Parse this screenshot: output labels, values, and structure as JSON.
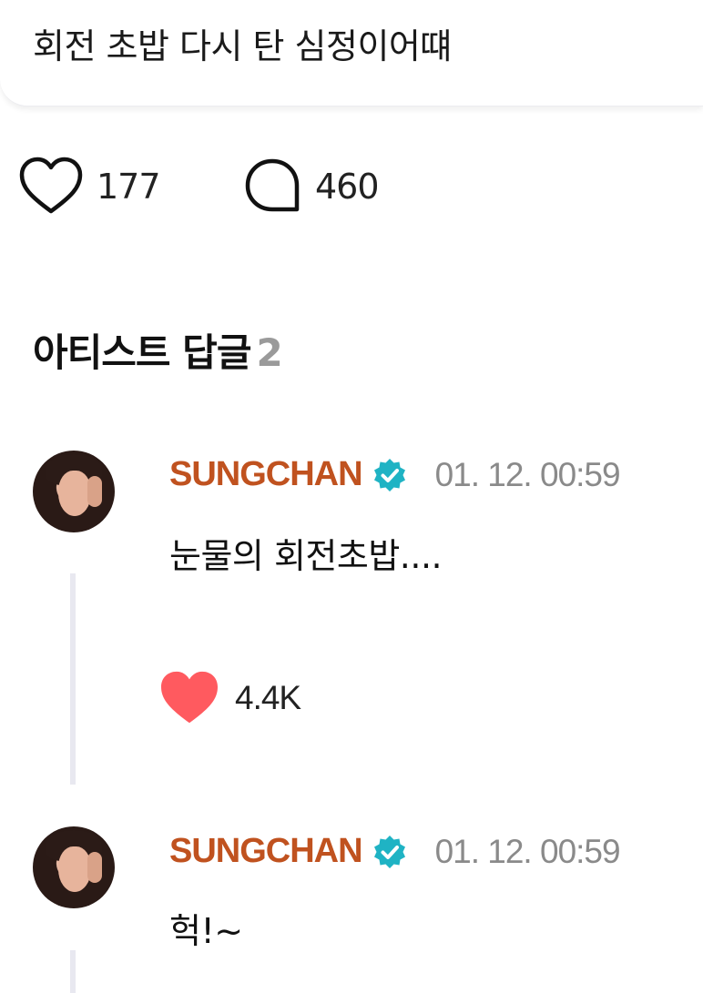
{
  "post": {
    "text": "회전 초밥 다시 탄 심정이어떄"
  },
  "actions": {
    "like_icon": "heart-outline-icon",
    "like_count": "177",
    "comment_icon": "speech-bubble-icon",
    "comment_count": "460"
  },
  "artist_replies": {
    "title": "아티스트 답글",
    "count": "2",
    "items": [
      {
        "author": "SUNGCHAN",
        "verified_icon": "verified-badge-icon",
        "timestamp": "01. 12. 00:59",
        "text": "눈물의 회전초밥....",
        "like_icon": "heart-filled-icon",
        "like_count": "4.4K"
      },
      {
        "author": "SUNGCHAN",
        "verified_icon": "verified-badge-icon",
        "timestamp": "01. 12. 00:59",
        "text": "헉!~"
      }
    ]
  },
  "colors": {
    "author": "#c0521f",
    "verified": "#1fb3c4",
    "heart_filled": "#ff5a5f",
    "timestamp": "#8a8a8a",
    "count_muted": "#9a9a9a",
    "thread_line": "#e8e8f0"
  }
}
